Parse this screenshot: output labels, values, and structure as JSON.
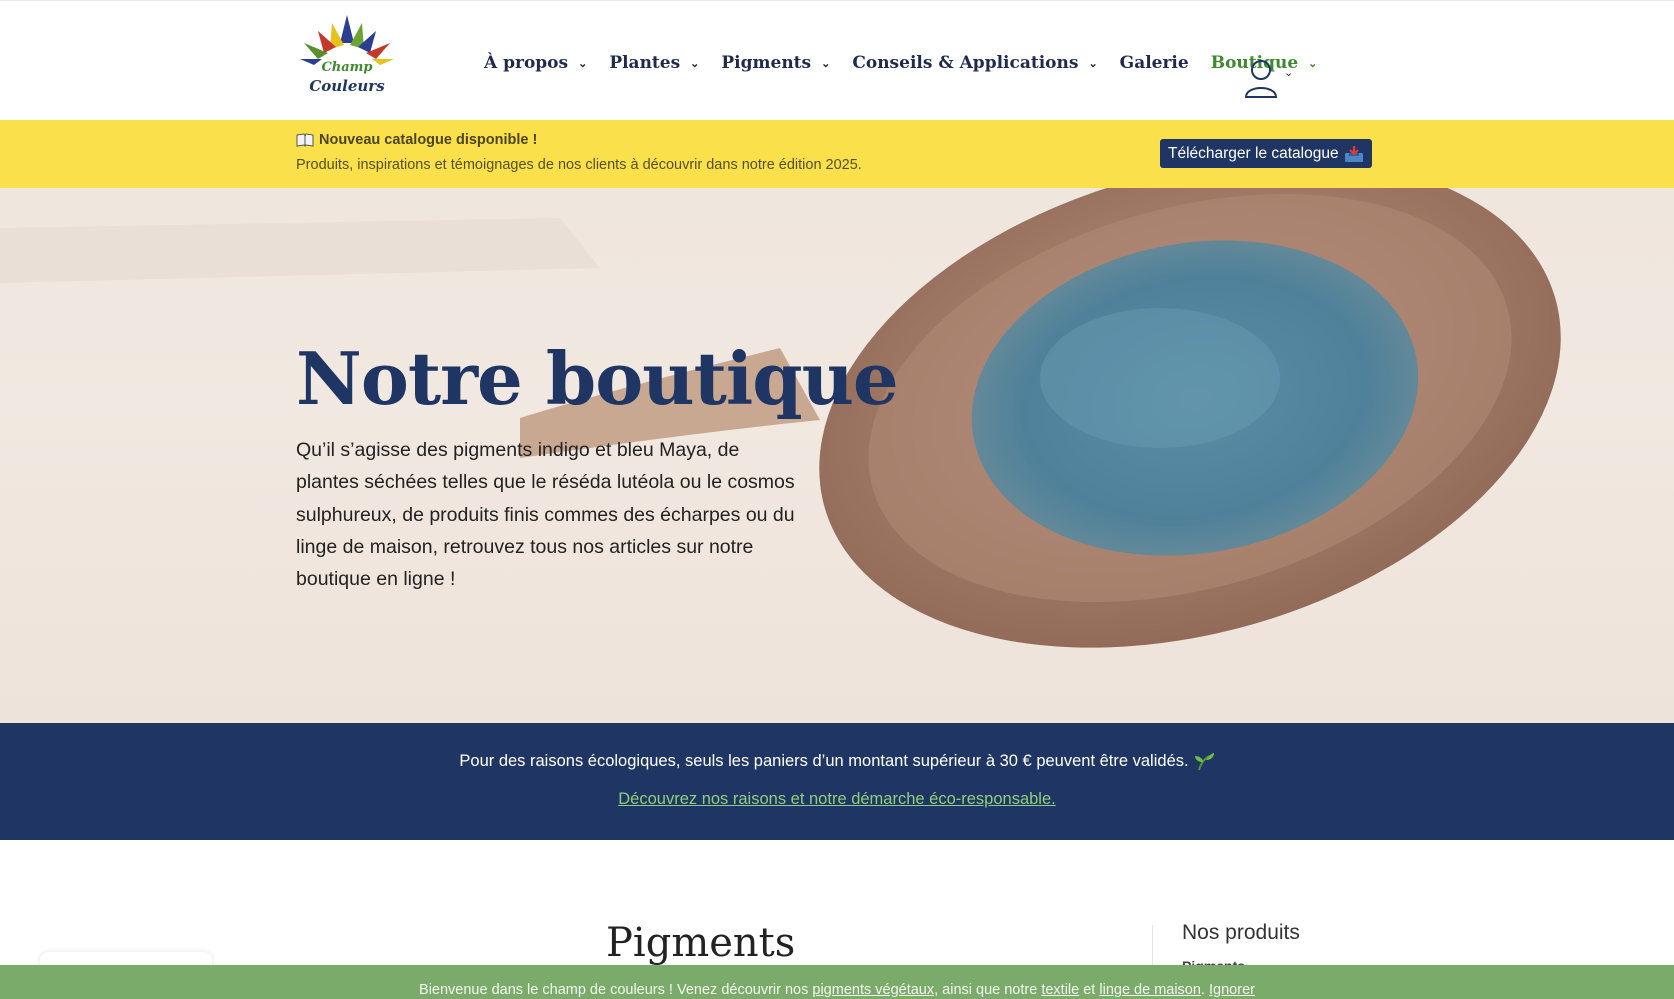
{
  "header": {
    "logo_alt": "Le Champ des Couleurs",
    "nav": [
      {
        "label": "À propos",
        "has_dropdown": true,
        "active": false
      },
      {
        "label": "Plantes",
        "has_dropdown": true,
        "active": false
      },
      {
        "label": "Pigments",
        "has_dropdown": true,
        "active": false
      },
      {
        "label": "Conseils & Applications",
        "has_dropdown": true,
        "active": false
      },
      {
        "label": "Galerie",
        "has_dropdown": false,
        "active": false
      },
      {
        "label": "Boutique",
        "has_dropdown": true,
        "active": true
      }
    ],
    "account_icon": "user-icon"
  },
  "announcement": {
    "icon": "open-book-icon",
    "title": "Nouveau catalogue disponible !",
    "subtitle": "Produits, inspirations et témoignages de nos clients à découvrir dans notre édition 2025.",
    "button_label": "Télécharger le catalogue",
    "button_icon": "inbox-tray-icon"
  },
  "hero": {
    "title": "Notre boutique",
    "text": "Qu’il s’agisse des pigments indigo et bleu Maya, de plantes séchées telles que le réséda lutéola ou le cosmos sulphureux, de produits finis commes des écharpes ou du linge de maison, retrouvez tous nos articles sur notre boutique en ligne !"
  },
  "eco_band": {
    "message": "Pour des raisons écologiques, seuls les paniers d’un montant supérieur à 30 € peuvent être validés.",
    "message_icon": "seedling-icon",
    "link": "Découvrez nos raisons et notre démarche éco-responsable."
  },
  "content": {
    "section_title": "Pigments",
    "sidebar_title": "Nos produits",
    "sidebar_first_item": "Pigments"
  },
  "notice": {
    "text_before": "Bienvenue dans le champ de couleurs ! Venez découvrir nos ",
    "link1": "pigments végétaux",
    "text_mid1": ", ainsi que notre ",
    "link2": "textile",
    "text_mid2": " et ",
    "link3": "linge de maison",
    "text_mid3": ". ",
    "dismiss": "Ignorer"
  },
  "colors": {
    "navy": "#1f3563",
    "yellow": "#fae14b",
    "green_active": "#3f8a2f",
    "notice_green": "#7aab6a"
  }
}
